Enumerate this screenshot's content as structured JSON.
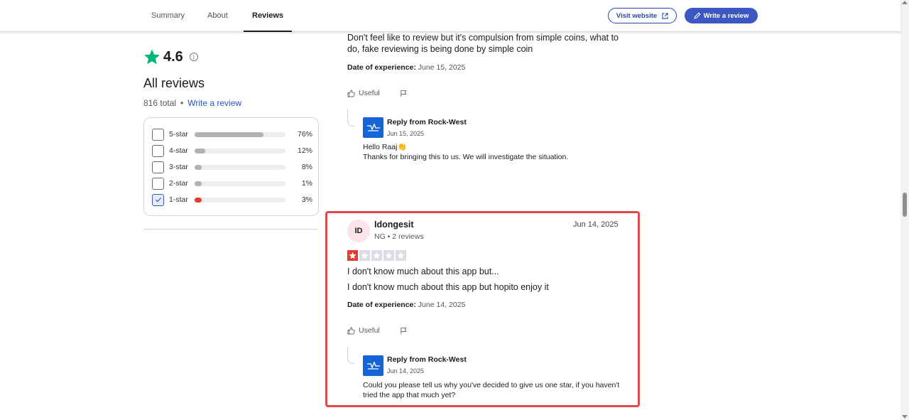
{
  "nav": {
    "tabs": [
      "Summary",
      "About",
      "Reviews"
    ],
    "visit_website": "Visit website",
    "write_review": "Write a review"
  },
  "sidebar": {
    "rating": "4.6",
    "heading": "All reviews",
    "total": "816 total",
    "separator": "•",
    "write_link": "Write a review",
    "filters": [
      {
        "label": "5-star",
        "percent": "76%",
        "fill": 0.76,
        "checked": false
      },
      {
        "label": "4-star",
        "percent": "12%",
        "fill": 0.12,
        "checked": false
      },
      {
        "label": "3-star",
        "percent": "8%",
        "fill": 0.08,
        "checked": false
      },
      {
        "label": "2-star",
        "percent": "1%",
        "fill": 0.01,
        "checked": false
      },
      {
        "label": "1-star",
        "percent": "3%",
        "fill": 0.03,
        "checked": true
      }
    ]
  },
  "review1": {
    "body_line1": "Don't feel like to review but it's compulsion from simple coins, what to",
    "body_line2": "do, fake reviewing is being done by simple coin",
    "doe_label": "Date of experience:",
    "doe_value": "June 15, 2025",
    "useful": "Useful",
    "reply": {
      "from": "Reply from Rock-West",
      "date": "Jun 15, 2025",
      "line1": "Hello Raaj👏",
      "line2": "Thanks for bringing this to us. We will investigate the situation."
    }
  },
  "review2": {
    "initials": "ID",
    "name": "Idongesit",
    "meta": "NG • 2 reviews",
    "date": "Jun 14, 2025",
    "stars": 1,
    "title": "I don't know much about this app but...",
    "body": "I don't know much about this app but hopito enjoy it",
    "doe_label": "Date of experience:",
    "doe_value": "June 14, 2025",
    "useful": "Useful",
    "reply": {
      "from": "Reply from Rock-West",
      "date": "Jun 14, 2025",
      "line1": "Could you please tell us why you've decided to give us one star, if you haven't",
      "line2": "tried the app that much yet?"
    }
  },
  "colors": {
    "accent": "#3c57c0",
    "star_green": "#00b67a",
    "star_red": "#e83a2e",
    "highlight": "#e0494b"
  }
}
